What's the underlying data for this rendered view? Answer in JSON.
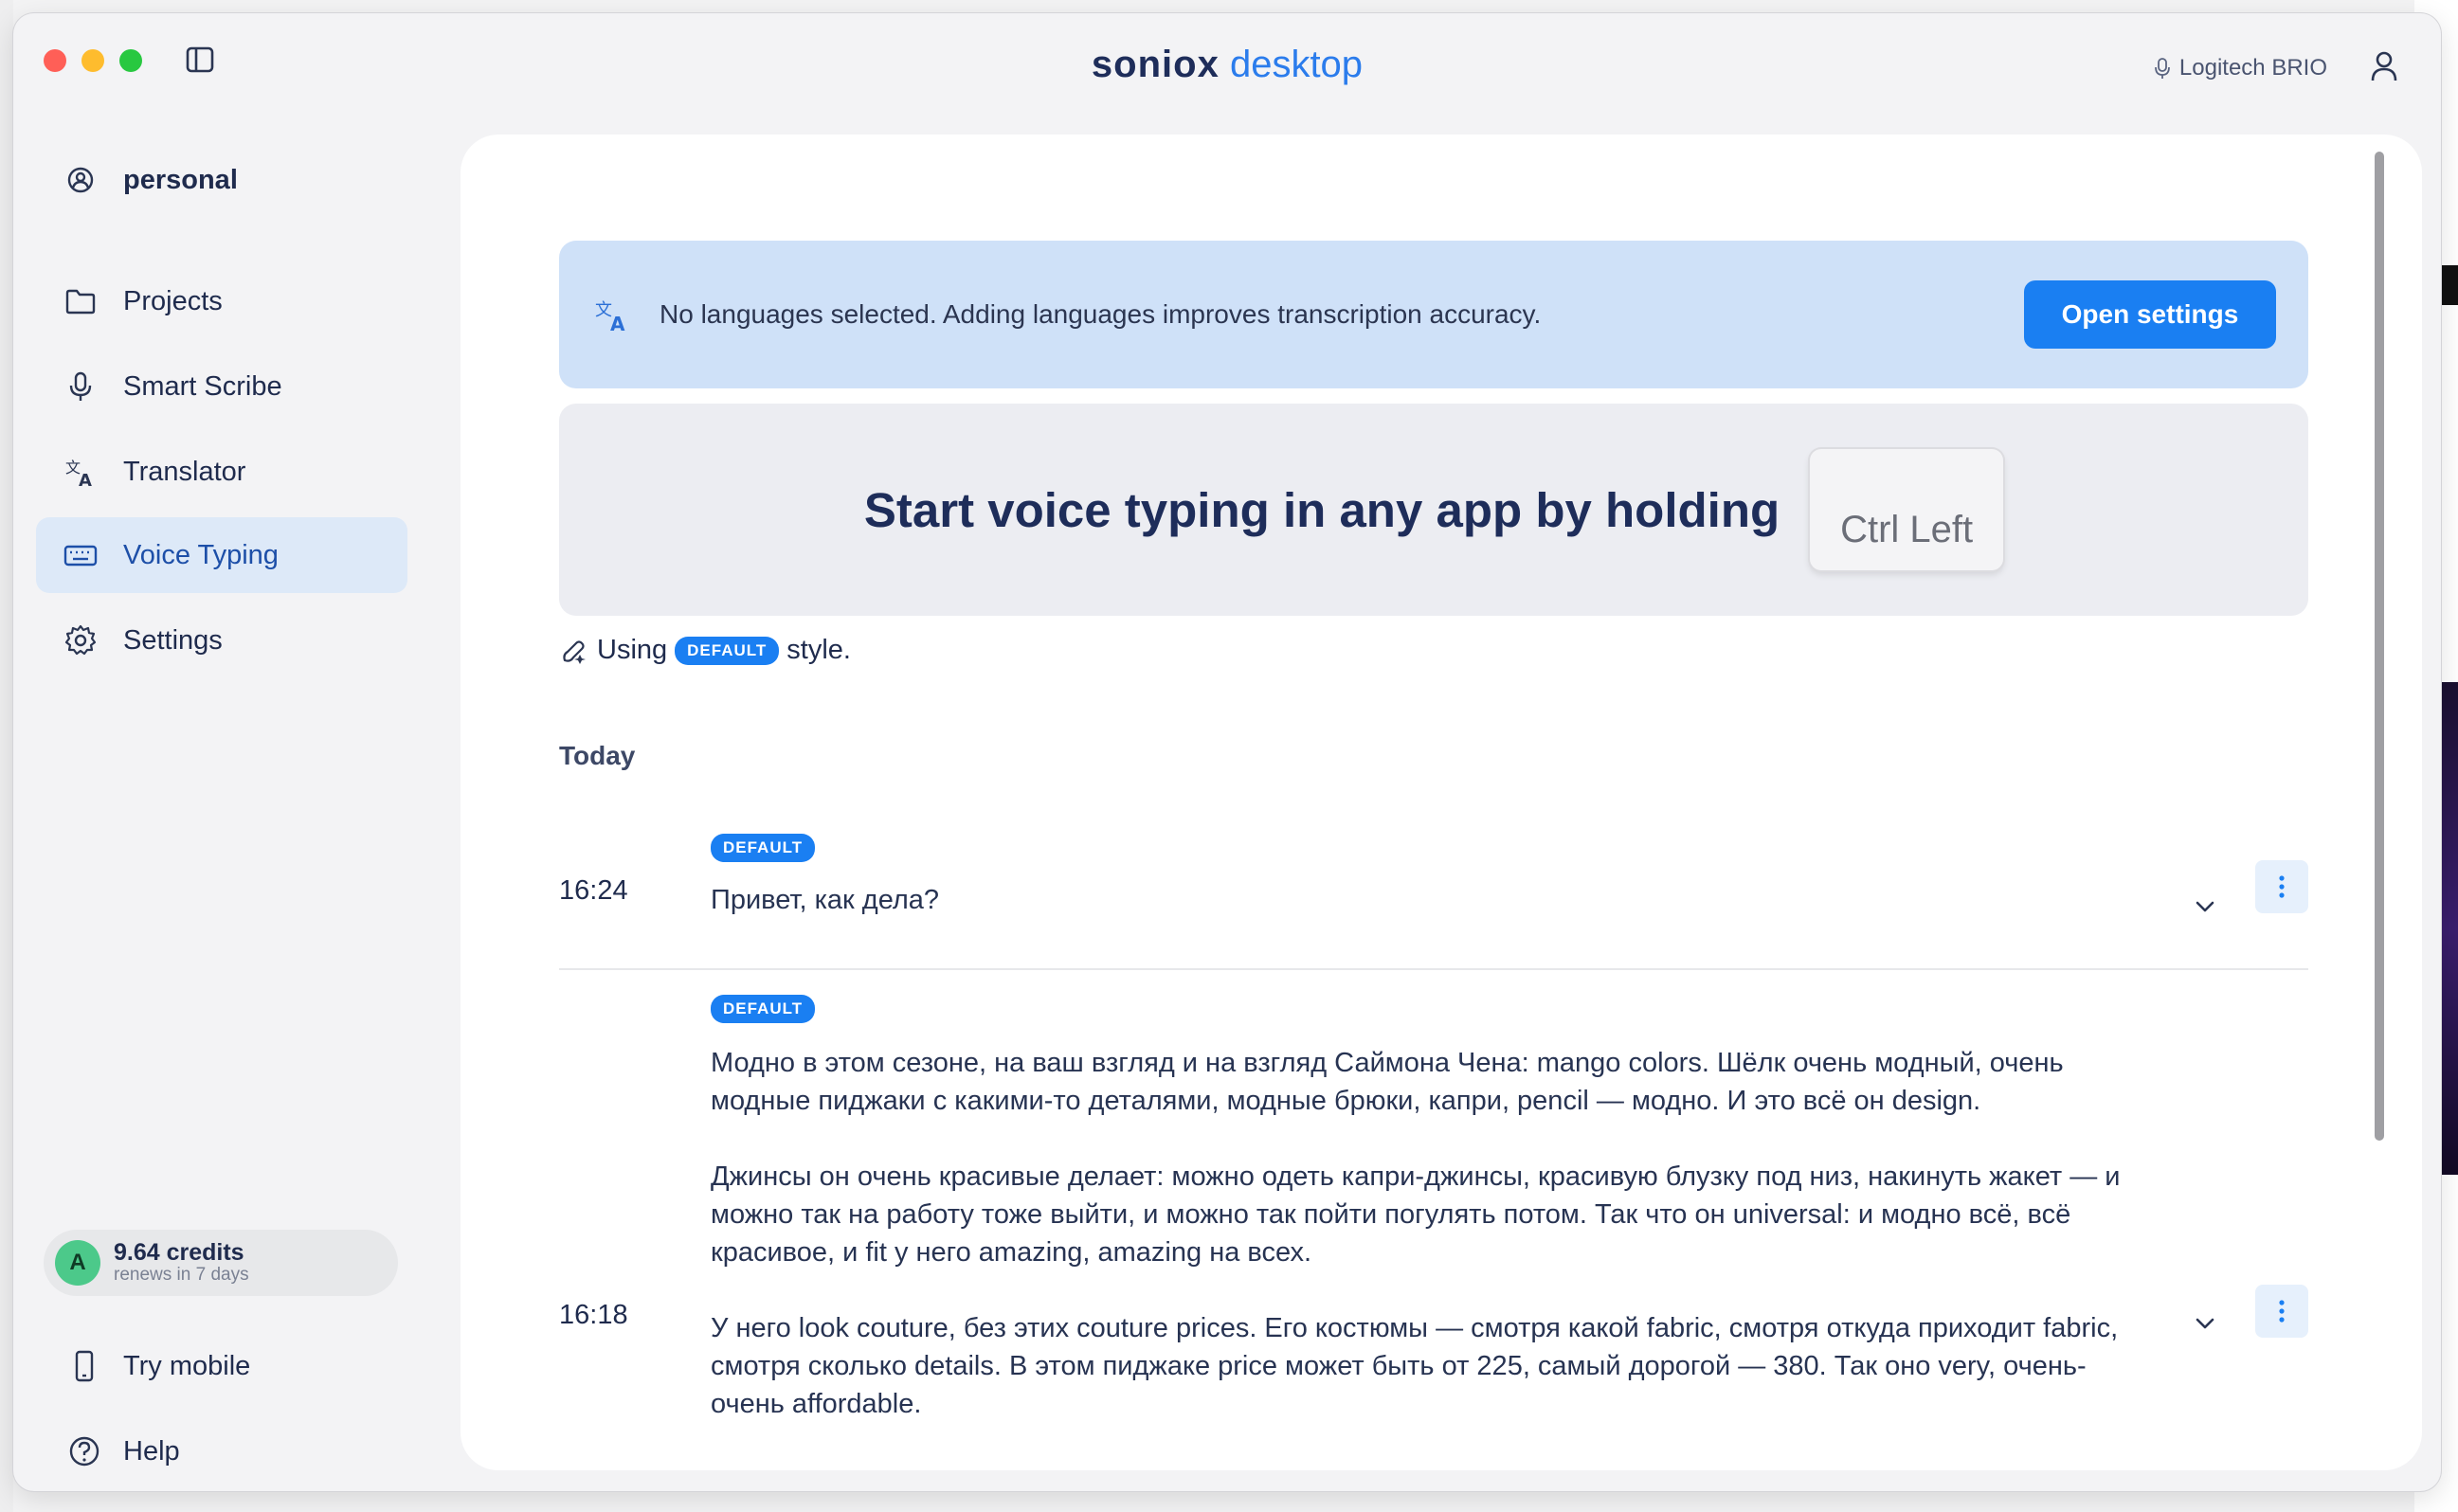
{
  "window": {
    "brand_primary": "soniox",
    "brand_secondary": "desktop",
    "mic_device": "Logitech BRIO"
  },
  "sidebar": {
    "account": "personal",
    "items": [
      {
        "label": "Projects",
        "icon": "folder-icon"
      },
      {
        "label": "Smart Scribe",
        "icon": "microphone-icon"
      },
      {
        "label": "Translator",
        "icon": "translate-icon"
      },
      {
        "label": "Voice Typing",
        "icon": "keyboard-icon",
        "active": true
      },
      {
        "label": "Settings",
        "icon": "gear-icon"
      }
    ],
    "credits": {
      "avatar_letter": "A",
      "amount": "9.64 credits",
      "renews": "renews in 7 days"
    },
    "bottom": [
      {
        "label": "Try mobile",
        "icon": "mobile-icon"
      },
      {
        "label": "Help",
        "icon": "help-icon"
      }
    ]
  },
  "main": {
    "language_banner": {
      "message": "No languages selected. Adding languages improves transcription accuracy.",
      "button": "Open settings"
    },
    "voice_banner": {
      "headline": "Start voice typing in any app by holding",
      "key": "Ctrl Left"
    },
    "style_line": {
      "prefix": "Using",
      "style": "DEFAULT",
      "suffix": "style."
    },
    "section": "Today",
    "entries": [
      {
        "time": "16:24",
        "badge": "DEFAULT",
        "paragraphs": [
          "Привет, как дела?"
        ]
      },
      {
        "time": "16:18",
        "badge": "DEFAULT",
        "paragraphs": [
          "Модно в этом сезоне, на ваш взгляд и на взгляд Саймона Чена: mango colors. Шёлк очень модный, очень модные пиджаки с какими-то деталями, модные брюки, капри, pencil — модно. И это всё он design.",
          "Джинсы он очень красивые делает: можно одеть капри-джинсы, красивую блузку под низ, накинуть жакет — и можно так на работу тоже выйти, и можно так пойти погулять потом. Так что он universal: и модно всё, всё красивое, и fit у него amazing, amazing на всех.",
          "У него look couture, без этих couture prices. Его костюмы — смотря какой fabric, смотря откуда приходит fabric, смотря сколько details. В этом пиджаке price может быть от 225, самый дорогой — 380. Так оно very, очень-очень affordable."
        ]
      }
    ]
  },
  "colors": {
    "accent": "#1a7ff2",
    "active_bg": "#dde9f8",
    "banner_blue": "#cfe1f8",
    "brand_dark": "#1e2d5a"
  }
}
